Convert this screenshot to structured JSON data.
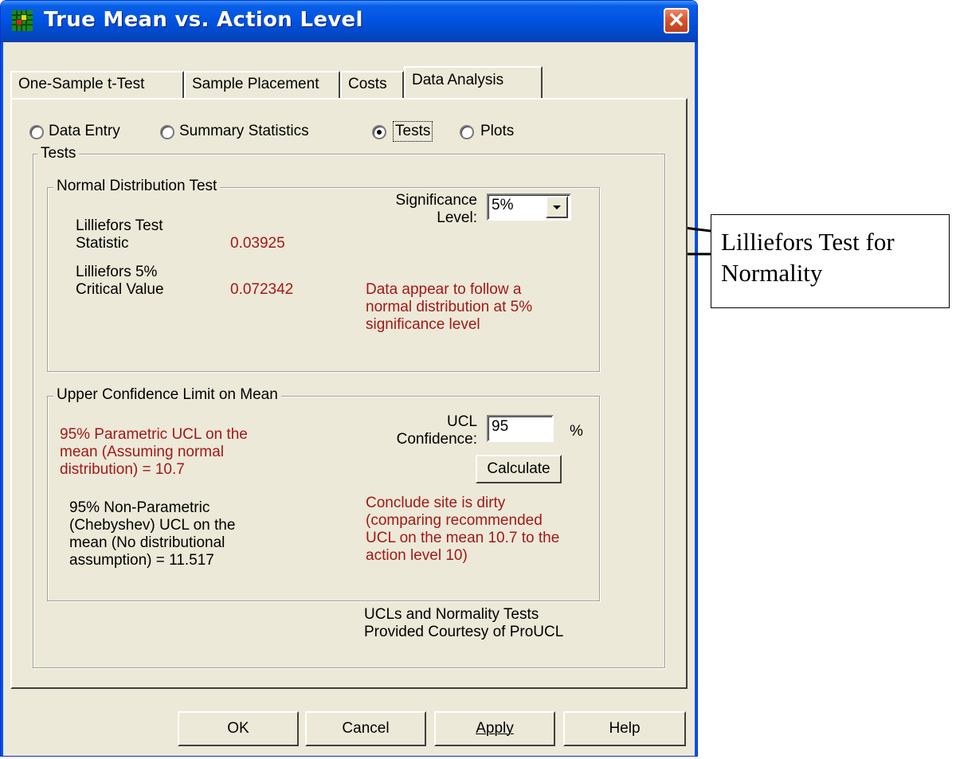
{
  "window": {
    "title": "True Mean vs. Action Level",
    "close_glyph": "✕"
  },
  "tabs": [
    {
      "label": "One-Sample t-Test",
      "active": false
    },
    {
      "label": "Sample Placement",
      "active": false
    },
    {
      "label": "Costs",
      "active": false
    },
    {
      "label": "Data Analysis",
      "active": true
    }
  ],
  "mode_options": [
    {
      "label": "Data Entry",
      "selected": false
    },
    {
      "label": "Summary Statistics",
      "selected": false
    },
    {
      "label": "Tests",
      "selected": true
    },
    {
      "label": "Plots",
      "selected": false
    }
  ],
  "tests_group": {
    "title": "Tests",
    "normal_test": {
      "title": "Normal Distribution Test",
      "stat_label_1": "Lilliefors Test",
      "stat_label_2": "Statistic",
      "stat_value": "0.03925",
      "crit_label_1": "Lilliefors 5%",
      "crit_label_2": "Critical Value",
      "crit_value": "0.072342",
      "significance_label_1": "Significance",
      "significance_label_2": "Level:",
      "significance_value": "5%",
      "result_lines": [
        "Data appear to follow a",
        "normal distribution at 5%",
        "significance level"
      ]
    },
    "ucl": {
      "title": "Upper Confidence Limit on Mean",
      "parametric_lines": [
        "95% Parametric UCL on the",
        "mean (Assuming normal",
        "distribution) = 10.7"
      ],
      "nonparametric_lines": [
        "95% Non-Parametric",
        "(Chebyshev) UCL on the",
        "mean (No distributional",
        "assumption) = 11.517"
      ],
      "confidence_label_1": "UCL",
      "confidence_label_2": "Confidence:",
      "confidence_value": "95",
      "percent_sign": "%",
      "calculate_label": "Calculate",
      "conclusion_lines": [
        "Conclude site is dirty",
        "(comparing recommended",
        "UCL on the mean 10.7 to the",
        "action level 10)"
      ]
    },
    "credit_lines": [
      "UCLs and Normality Tests",
      "Provided Courtesy of ProUCL"
    ]
  },
  "buttons": {
    "ok": "OK",
    "cancel": "Cancel",
    "apply": "Apply",
    "help": "Help"
  },
  "annotation": {
    "lines": [
      "Lilliefors Test for",
      "Normality"
    ]
  },
  "colors": {
    "result_red": "#a31818",
    "titlebar_blue": "#0054e3",
    "dialog_bg": "#ece9d8"
  }
}
